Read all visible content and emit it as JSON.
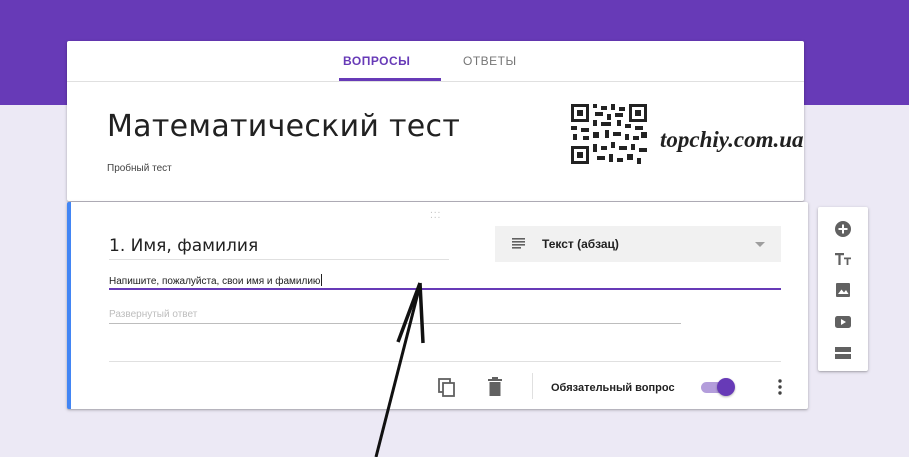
{
  "tabs": {
    "questions": "ВОПРОСЫ",
    "answers": "ОТВЕТЫ"
  },
  "form": {
    "title": "Математический тест",
    "description": "Пробный тест"
  },
  "watermark": "topchiy.com.ua",
  "question": {
    "title": "1. Имя, фамилия",
    "type": "Текст (абзац)",
    "description": "Напишите, пожалуйста, свои имя и фамилию",
    "answer_placeholder": "Развернутый ответ",
    "required_label": "Обязательный вопрос",
    "required": true
  },
  "colors": {
    "brand": "#673ab7",
    "accent_border": "#4285f4",
    "background": "#ece9f5"
  },
  "icons": {
    "toolbar": [
      "add-question-icon",
      "add-title-icon",
      "add-image-icon",
      "add-video-icon",
      "add-section-icon"
    ],
    "footer": [
      "duplicate-icon",
      "delete-icon",
      "more-vert-icon"
    ],
    "type_select": [
      "paragraph-icon",
      "dropdown-arrow-icon"
    ]
  }
}
